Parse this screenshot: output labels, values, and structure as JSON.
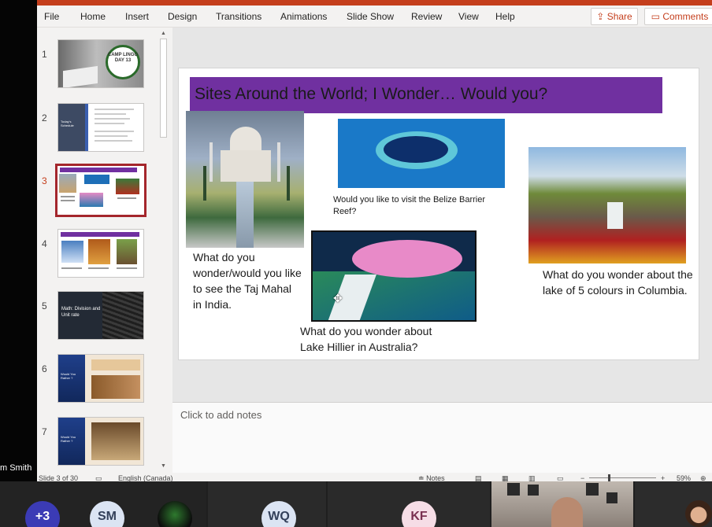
{
  "participant_name_partial": "m Smith",
  "menu": [
    "File",
    "Home",
    "Insert",
    "Design",
    "Transitions",
    "Animations",
    "Slide Show",
    "Review",
    "View",
    "Help"
  ],
  "share_label": "Share",
  "comments_label": "Comments",
  "thumbnails": [
    {
      "number": "1",
      "title": "CAMP LINGO DAY 13"
    },
    {
      "number": "2",
      "title": "Today's Schedule"
    },
    {
      "number": "3",
      "title": ""
    },
    {
      "number": "4",
      "title": ""
    },
    {
      "number": "5",
      "title": "Math: Division and Unit rate"
    },
    {
      "number": "6",
      "title": "Would You Rather ?"
    },
    {
      "number": "7",
      "title": "Would You Rather ?"
    }
  ],
  "slide": {
    "title": "Sites Around  the World; I Wonder… Would you?",
    "captions": {
      "taj": "What do you wonder/would you like to see the Taj Mahal in India.",
      "belize": "Would you like to visit the Belize Barrier Reef?",
      "hillier": "What do you wonder about Lake Hillier in Australia?",
      "columbia": "What do you wonder about the lake of 5 colours in Columbia."
    }
  },
  "notes_placeholder": "Click to add notes",
  "status": {
    "slide_counter": "Slide 3 of 30",
    "language": "English (Canada)",
    "notes_label": "Notes",
    "zoom": "59%"
  },
  "participants": {
    "more_count": "+3",
    "initials_1": "SM",
    "initials_2": "WQ",
    "initials_3": "KF"
  },
  "colors": {
    "accent": "#c43e1c",
    "title_bar": "#7030a0",
    "active_thumb_border": "#a4262c"
  }
}
